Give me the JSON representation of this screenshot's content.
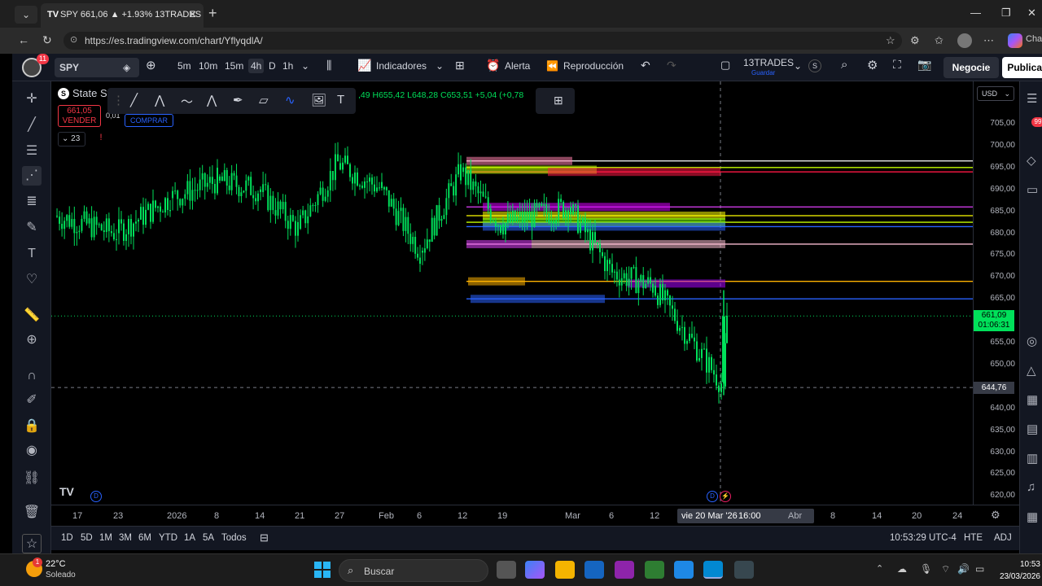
{
  "browser": {
    "tab_title": "SPY 661,06 ▲ +1.93% 13TRADES",
    "tab_favicon": "TV",
    "url": "https://es.tradingview.com/chart/YflyqdlA/"
  },
  "tv_toolbar": {
    "notification_count": "11",
    "symbol": "SPY",
    "intervals": [
      "5m",
      "10m",
      "15m",
      "4h",
      "D",
      "1h"
    ],
    "active_interval": "4h",
    "indicators_label": "Indicadores",
    "alert_label": "Alerta",
    "replay_label": "Reproducción",
    "layout_name": "13TRADES",
    "layout_sub": "Guardar",
    "layout_badge": "S",
    "trade_button": "Negocie",
    "publish_button": "Publicar",
    "right_cut_label": "Cha",
    "right_badge": "99"
  },
  "legend": {
    "title": "State St",
    "ohlc": ",49  H655,42  L648,28  C653,51  +5,04 (+0,78",
    "sell_price": "661,05",
    "sell_label": "VENDER",
    "spread": "0,01",
    "buy_label": "COMPRAR",
    "indicator_count": "23",
    "warning": "!"
  },
  "price_scale": {
    "currency": "USD",
    "labels": [
      "705,00",
      "700,00",
      "695,00",
      "690,00",
      "685,00",
      "680,00",
      "675,00",
      "670,00",
      "665,00",
      "655,00",
      "650,00",
      "640,00",
      "635,00",
      "630,00",
      "625,00",
      "620,00"
    ],
    "current_price": "661,09",
    "countdown": "01:06:31",
    "crosshair_price": "644,76"
  },
  "time_axis": {
    "labels": [
      "17",
      "23",
      "2026",
      "8",
      "14",
      "21",
      "27",
      "Feb",
      "6",
      "12",
      "19",
      "Mar",
      "6",
      "12",
      "Abr",
      "8",
      "14",
      "20",
      "24"
    ],
    "crosshair_date": "vie 20 Mar '26",
    "crosshair_time": "16:00"
  },
  "bottom_bar": {
    "ranges": [
      "1D",
      "5D",
      "1M",
      "3M",
      "6M",
      "YTD",
      "1A",
      "5A",
      "Todos"
    ],
    "time": "10:53:29 UTC-4",
    "session": "HTE",
    "adj": "ADJ"
  },
  "taskbar": {
    "temperature": "22°C",
    "weather": "Soleado",
    "weather_badge": "1",
    "search_placeholder": "Buscar",
    "time": "10:53",
    "date": "23/03/2026"
  },
  "chart_data": {
    "type": "candlestick",
    "symbol": "SPY",
    "ylim": [
      617,
      710
    ],
    "price_series_approx": [
      {
        "x": "17",
        "close": 684
      },
      {
        "x": "23",
        "close": 680
      },
      {
        "x": "2026",
        "close": 688
      },
      {
        "x": "8",
        "close": 692
      },
      {
        "x": "14",
        "close": 690
      },
      {
        "x": "21",
        "close": 681
      },
      {
        "x": "27",
        "close": 696
      },
      {
        "x": "Feb",
        "close": 690
      },
      {
        "x": "6",
        "close": 676
      },
      {
        "x": "12",
        "close": 694
      },
      {
        "x": "19",
        "close": 682
      },
      {
        "x": "Mar",
        "close": 686
      },
      {
        "x": "6",
        "close": 671
      },
      {
        "x": "12",
        "close": 668
      },
      {
        "x": "vie 20 Mar '26",
        "close": 645
      },
      {
        "x": "now",
        "close": 661.09
      }
    ],
    "horizontal_levels": [
      {
        "price": 696.5,
        "color": "#ffffff"
      },
      {
        "price": 695,
        "color": "#c6ff00"
      },
      {
        "price": 694,
        "color": "#ff1744"
      },
      {
        "price": 686,
        "color": "#e040fb"
      },
      {
        "price": 684,
        "color": "#ffff00"
      },
      {
        "price": 682.5,
        "color": "#c6ff00"
      },
      {
        "price": 681.5,
        "color": "#2962ff"
      },
      {
        "price": 677.5,
        "color": "#f8bbd0"
      },
      {
        "price": 669,
        "color": "#ffb300"
      },
      {
        "price": 665,
        "color": "#2962ff"
      }
    ]
  }
}
